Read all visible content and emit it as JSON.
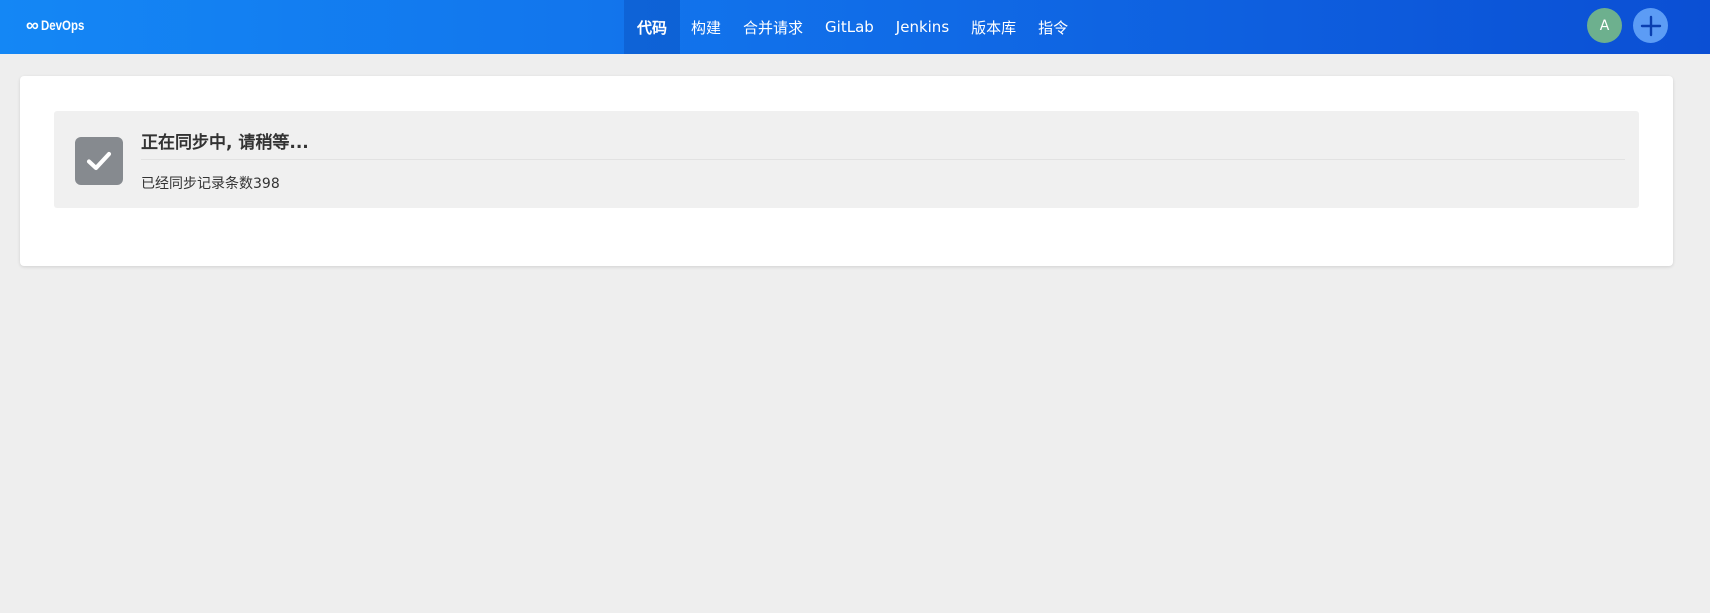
{
  "app": {
    "brand_icon": "∞",
    "brand_name": "DevOps"
  },
  "nav": {
    "items": [
      {
        "label": "代码",
        "active": true
      },
      {
        "label": "构建",
        "active": false
      },
      {
        "label": "合并请求",
        "active": false
      },
      {
        "label": "GitLab",
        "active": false
      },
      {
        "label": "Jenkins",
        "active": false
      },
      {
        "label": "版本库",
        "active": false
      },
      {
        "label": "指令",
        "active": false
      }
    ]
  },
  "user": {
    "avatar_letter": "A",
    "avatar_color": "#6db08e"
  },
  "actions": {
    "add_icon": "plus-icon"
  },
  "sync_notice": {
    "icon": "check-icon",
    "title": "正在同步中, 请稍等...",
    "detail": "已经同步记录条数398"
  },
  "colors": {
    "topbar_start": "#1487f5",
    "topbar_end": "#0b4fd4",
    "status_icon_bg": "#868a8f",
    "page_bg": "#eeeeee"
  }
}
